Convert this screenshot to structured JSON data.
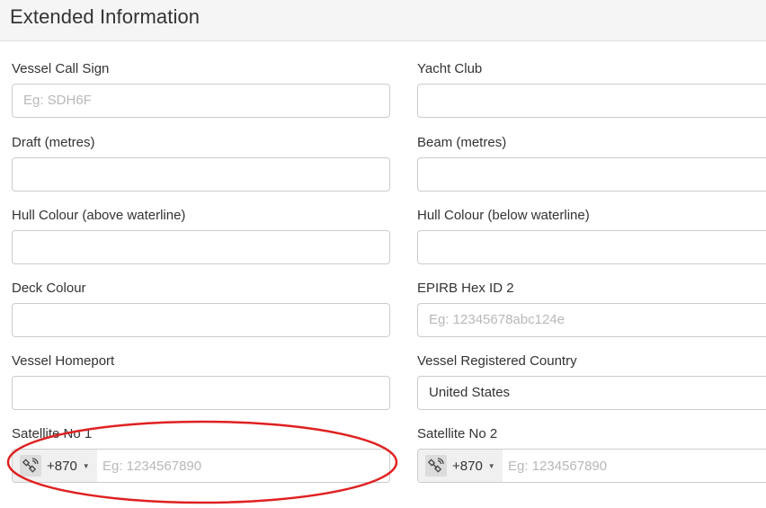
{
  "header": {
    "title": "Extended Information"
  },
  "fields": {
    "call_sign": {
      "label": "Vessel Call Sign",
      "value": "",
      "placeholder": "Eg: SDH6F"
    },
    "yacht_club": {
      "label": "Yacht Club",
      "value": "",
      "placeholder": ""
    },
    "draft": {
      "label": "Draft (metres)",
      "value": "",
      "placeholder": ""
    },
    "beam": {
      "label": "Beam (metres)",
      "value": "",
      "placeholder": ""
    },
    "hull_above": {
      "label": "Hull Colour (above waterline)",
      "value": "",
      "placeholder": ""
    },
    "hull_below": {
      "label": "Hull Colour (below waterline)",
      "value": "",
      "placeholder": ""
    },
    "deck_colour": {
      "label": "Deck Colour",
      "value": "",
      "placeholder": ""
    },
    "epirb2": {
      "label": "EPIRB Hex ID 2",
      "value": "",
      "placeholder": "Eg: 12345678abc124e"
    },
    "homeport": {
      "label": "Vessel Homeport",
      "value": "",
      "placeholder": ""
    },
    "reg_country": {
      "label": "Vessel Registered Country",
      "value": "United States",
      "placeholder": ""
    },
    "sat1": {
      "label": "Satellite No 1",
      "dial_code": "+870",
      "icon": "satellite-icon",
      "placeholder": "Eg: 1234567890"
    },
    "sat2": {
      "label": "Satellite No 2",
      "dial_code": "+870",
      "icon": "satellite-icon",
      "placeholder": "Eg: 1234567890"
    }
  },
  "annotation": {
    "shape": "ellipse",
    "color": "#e02020",
    "target": "Satellite No 1"
  }
}
